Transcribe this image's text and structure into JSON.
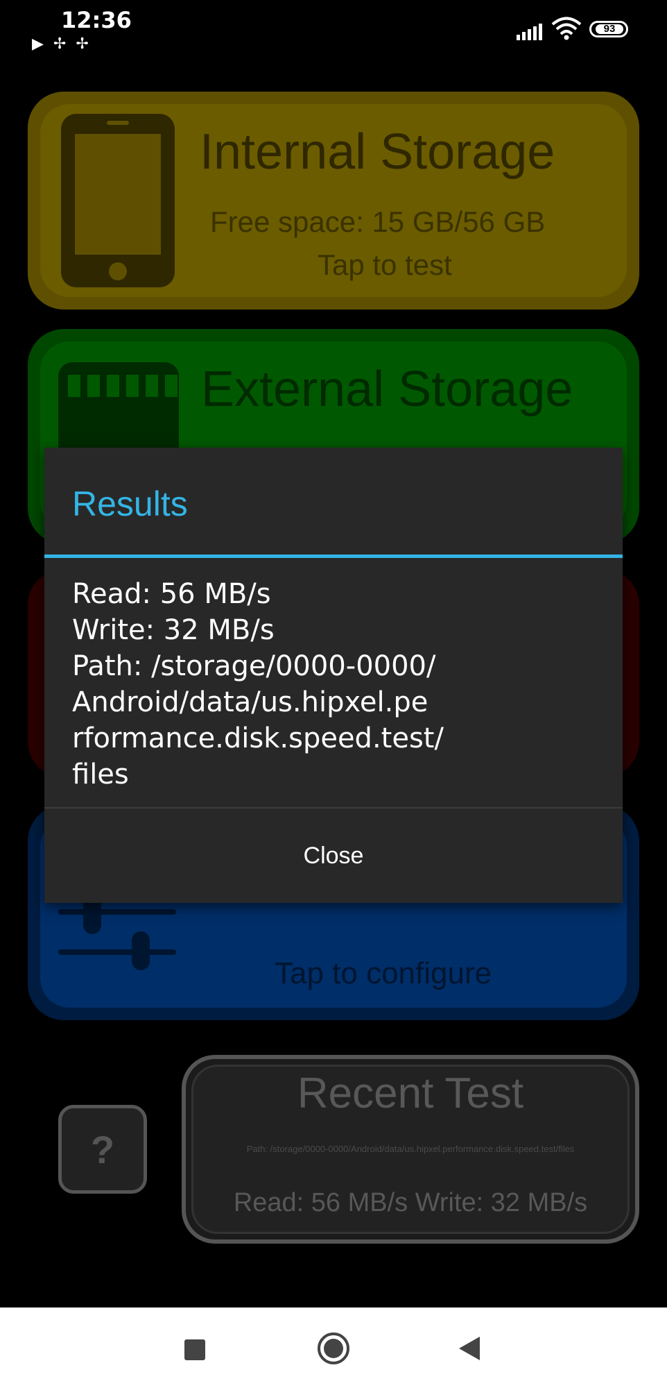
{
  "status_bar": {
    "time": "12:36",
    "notification_icons": [
      "play-store-icon",
      "pinwheel-icon",
      "pinwheel-icon"
    ],
    "battery_level": "93"
  },
  "cards": {
    "internal": {
      "title": "Internal Storage",
      "free_space": "Free space: 15 GB/56 GB",
      "action": "Tap to test",
      "color": "#6b5c00"
    },
    "external": {
      "title": "External Storage",
      "color": "#005900"
    },
    "custom": {
      "action": "Tap to configure",
      "color": "#002e69"
    }
  },
  "help": {
    "label": "?"
  },
  "recent": {
    "title": "Recent Test",
    "path": "Path: /storage/0000-0000/Android/data/us.hipxel.performance.disk.speed.test/files",
    "results": "Read: 56 MB/s Write: 32 MB/s"
  },
  "dialog": {
    "title": "Results",
    "body": "Read: 56 MB/s\nWrite: 32 MB/s\nPath: /storage/0000-0000/\nAndroid/data/us.hipxel.pe\nrformance.disk.speed.test/\nfiles",
    "close_label": "Close",
    "accent_color": "#33b5e5"
  },
  "nav": {
    "icons": [
      "recents-icon",
      "home-icon",
      "back-icon"
    ]
  }
}
